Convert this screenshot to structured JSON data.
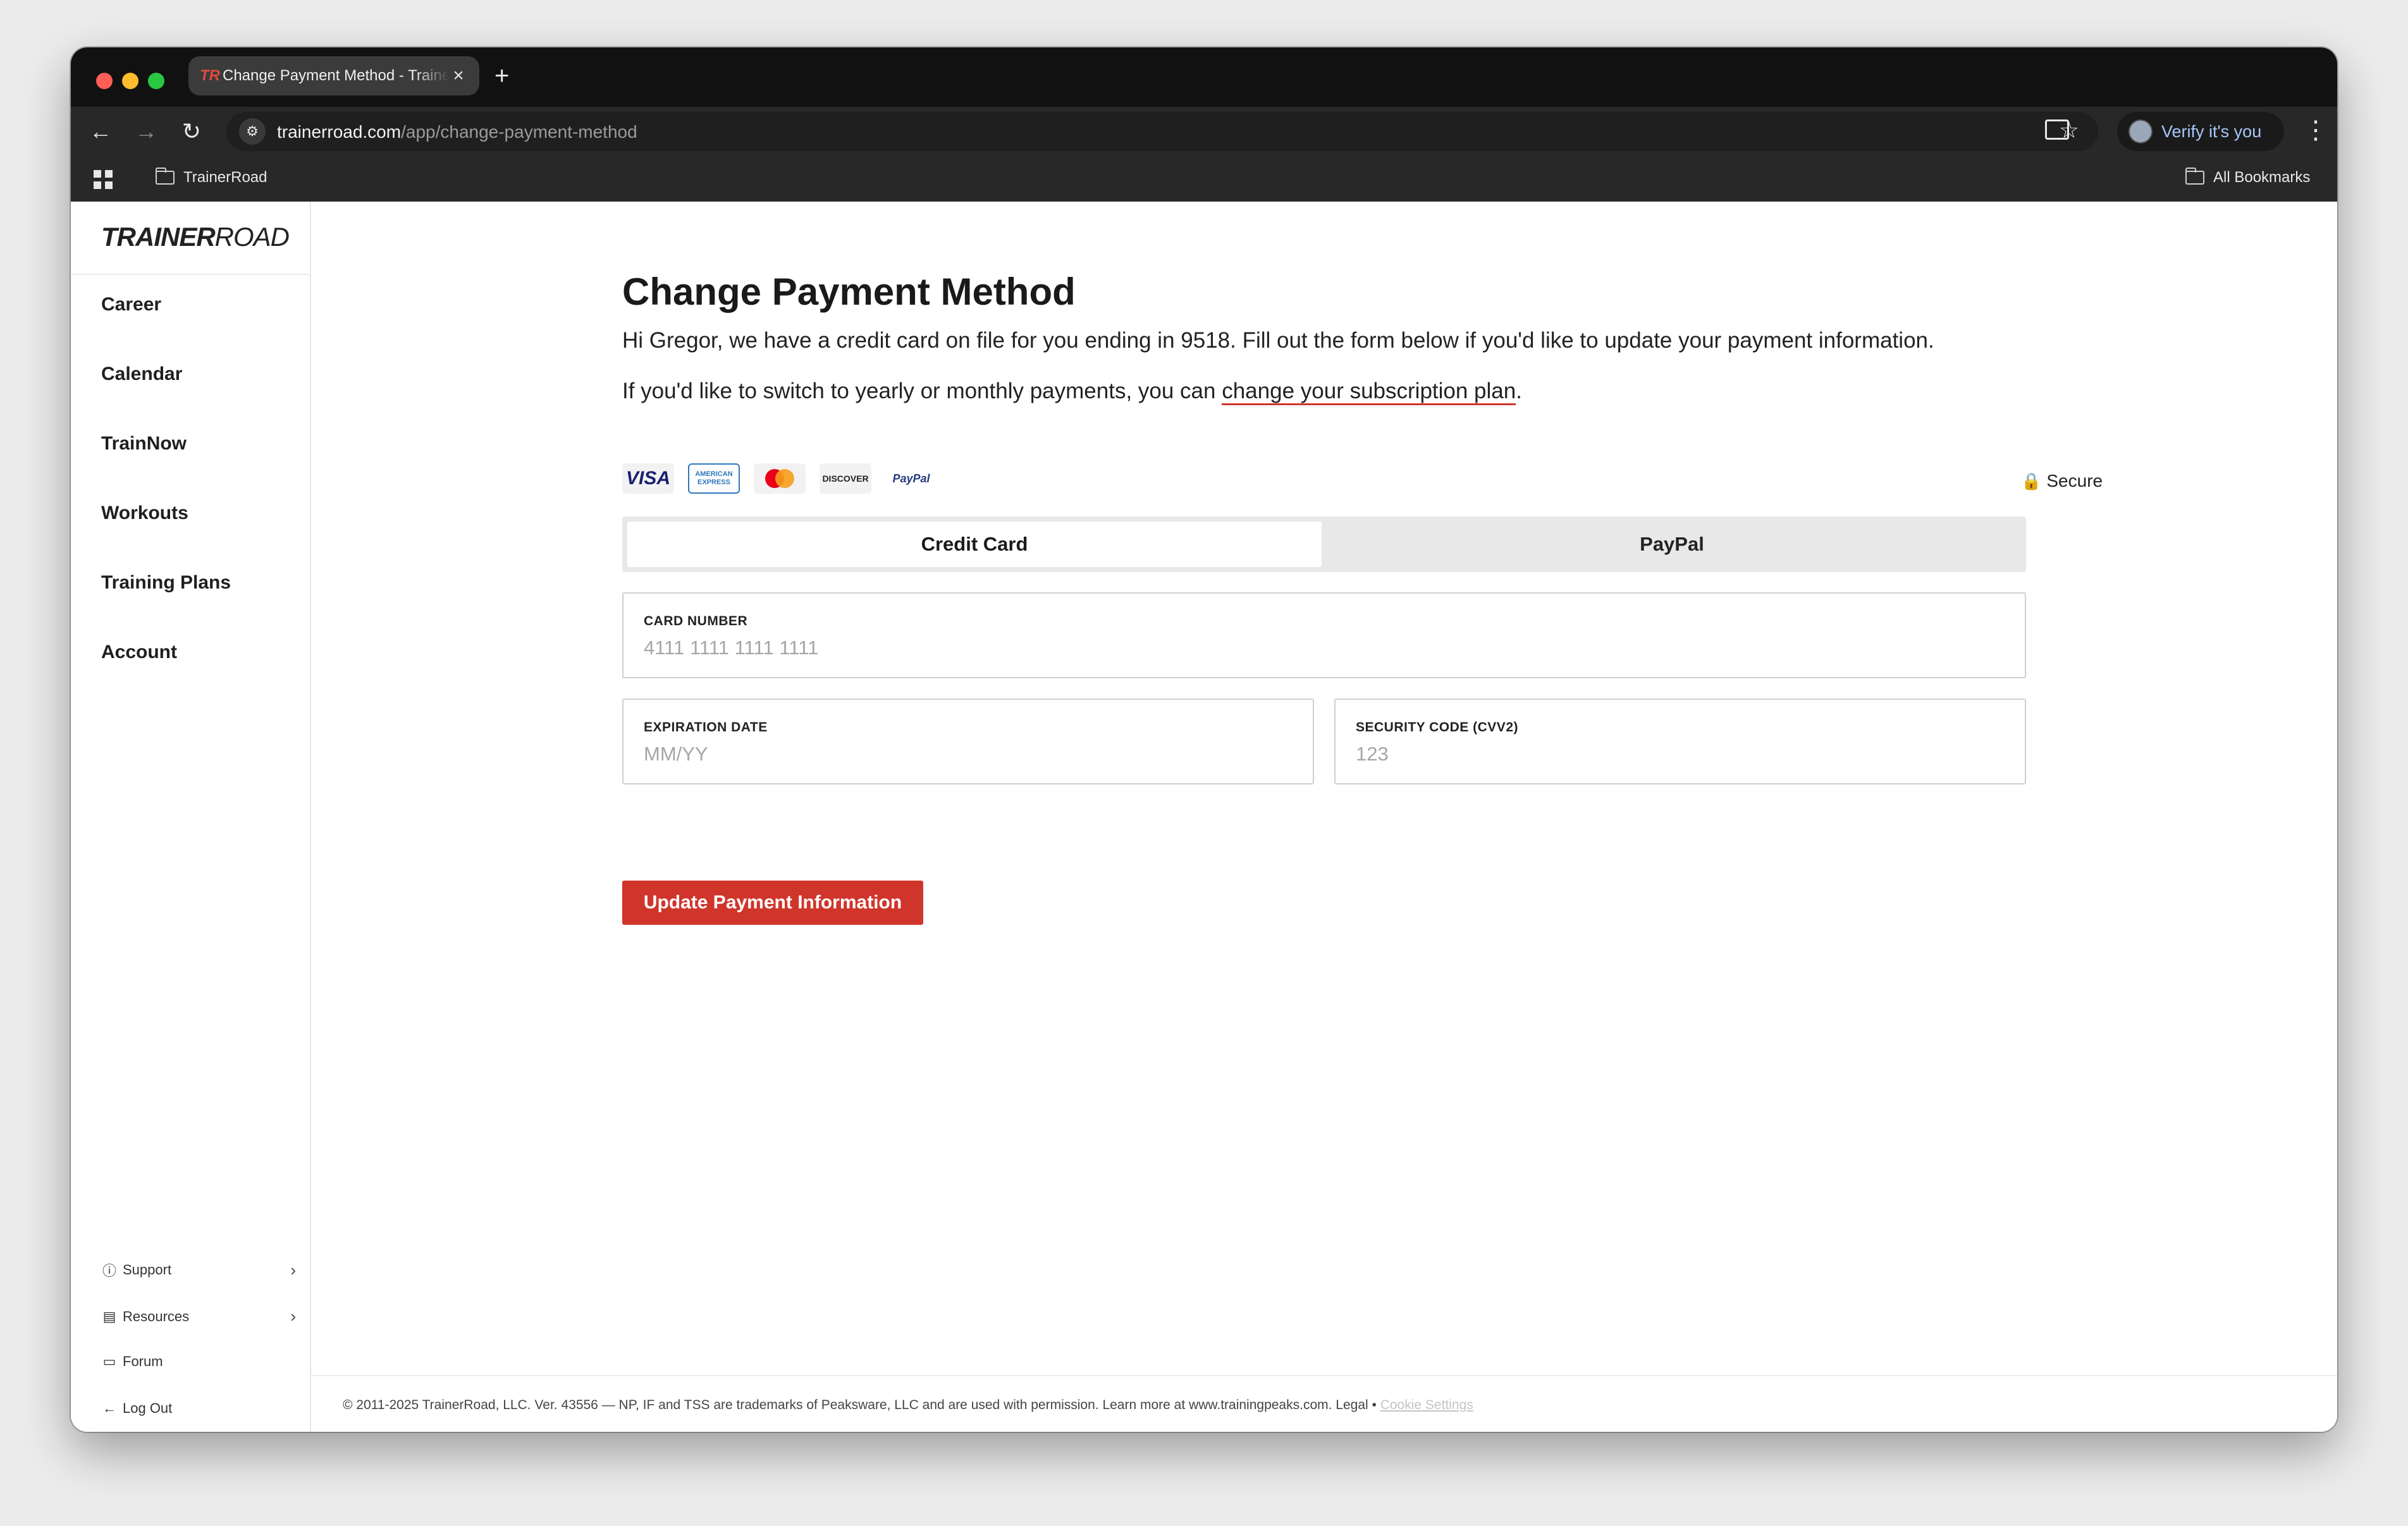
{
  "browser": {
    "tab_favicon": "TR",
    "tab_title": "Change Payment Method - TrainerRoad",
    "url_host": "trainerroad.com",
    "url_path": "/app/change-payment-method",
    "verify_label": "Verify it's you",
    "bookmarks": [
      "TrainerRoad"
    ],
    "all_bookmarks_label": "All Bookmarks"
  },
  "sidebar": {
    "logo_bold": "TRAINER",
    "logo_light": "ROAD",
    "nav": [
      "Career",
      "Calendar",
      "TrainNow",
      "Workouts",
      "Training Plans",
      "Account"
    ],
    "bottom": [
      {
        "label": "Support",
        "icon": "help-circle-icon",
        "has_arrow": true
      },
      {
        "label": "Resources",
        "icon": "news-icon",
        "has_arrow": true
      },
      {
        "label": "Forum",
        "icon": "chat-icon",
        "has_arrow": false
      },
      {
        "label": "Log Out",
        "icon": "arrow-left-icon",
        "has_arrow": false
      }
    ]
  },
  "main": {
    "title": "Change Payment Method",
    "intro_line1": "Hi Gregor, we have a credit card on file for you ending in 9518. Fill out the form below if you'd like to update your payment information.",
    "intro_line2_prefix": "If you'd like to switch to yearly or monthly payments, you can ",
    "intro_line2_link": "change your subscription plan",
    "intro_line2_suffix": ".",
    "payment_logos": [
      "VISA",
      "AMERICAN EXPRESS",
      "mastercard",
      "DISCOVER",
      "PayPal"
    ],
    "secure_label": "Secure",
    "tabs": {
      "credit_card": "Credit Card",
      "paypal": "PayPal",
      "active": "Credit Card"
    },
    "card_number": {
      "label": "CARD NUMBER",
      "placeholder": "4111 1111 1111 1111",
      "value": ""
    },
    "expiration": {
      "label": "EXPIRATION DATE",
      "placeholder": "MM/YY",
      "value": ""
    },
    "cvv": {
      "label": "SECURITY CODE (CVV2)",
      "placeholder": "123",
      "value": ""
    },
    "submit_label": "Update Payment Information"
  },
  "footer": {
    "text": "© 2011-2025 TrainerRoad, LLC. Ver. 43556 — NP, IF and TSS are trademarks of Peaksware, LLC and are used with permission. Learn more at www.trainingpeaks.com. Legal • ",
    "cookie_link": "Cookie Settings"
  },
  "colors": {
    "brand_red": "#d0352b",
    "browser_chrome": "#111111",
    "toolbar": "#282828"
  }
}
